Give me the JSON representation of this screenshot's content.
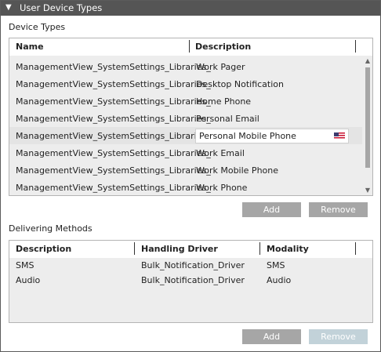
{
  "header": {
    "title": "User Device Types"
  },
  "device_types": {
    "section_label": "Device Types",
    "columns": {
      "name": "Name",
      "description": "Description"
    },
    "rows": [
      {
        "name": "ManagementView_SystemSettings_Libraries_",
        "description": "Work Pager"
      },
      {
        "name": "ManagementView_SystemSettings_Libraries_",
        "description": "Desktop Notification"
      },
      {
        "name": "ManagementView_SystemSettings_Libraries_",
        "description": "Home Phone"
      },
      {
        "name": "ManagementView_SystemSettings_Libraries_",
        "description": "Personal Email"
      },
      {
        "name": "ManagementView_SystemSettings_Libraries_",
        "description": "Personal Mobile Phone"
      },
      {
        "name": "ManagementView_SystemSettings_Libraries_",
        "description": "Work Email"
      },
      {
        "name": "ManagementView_SystemSettings_Libraries_",
        "description": "Work Mobile Phone"
      },
      {
        "name": "ManagementView_SystemSettings_Libraries_",
        "description": "Work Phone"
      }
    ],
    "selected_index": 4,
    "flag_icon": "us-flag-icon",
    "add_label": "Add",
    "remove_label": "Remove"
  },
  "delivering_methods": {
    "section_label": "Delivering Methods",
    "columns": {
      "description": "Description",
      "handling_driver": "Handling Driver",
      "modality": "Modality"
    },
    "rows": [
      {
        "description": "SMS",
        "handling_driver": "Bulk_Notification_Driver",
        "modality": "SMS"
      },
      {
        "description": "Audio",
        "handling_driver": "Bulk_Notification_Driver",
        "modality": "Audio"
      }
    ],
    "add_label": "Add",
    "remove_label": "Remove"
  },
  "colors": {
    "header_bg": "#555555",
    "button_bg": "#a6a6a6",
    "button_disabled_bg": "#c2d2d9"
  }
}
